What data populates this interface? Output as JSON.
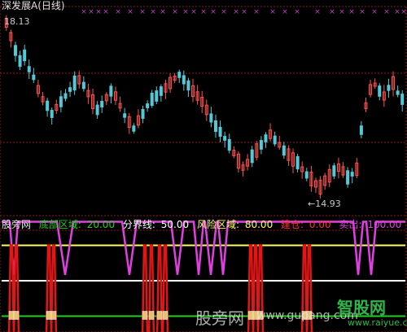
{
  "header": {
    "title": "深发展A(日线)",
    "high_label": "18.13",
    "low_label": "←14.93"
  },
  "indicator": {
    "name": "股旁网",
    "bottom_zone": {
      "label": "底部区域:",
      "value": "20.00"
    },
    "divider": {
      "label": "分界线:",
      "value": "50.00"
    },
    "risk_zone": {
      "label": "风险区域:",
      "value": "80.00"
    },
    "build": {
      "label": "建仓:",
      "value": "0.00"
    },
    "sell": {
      "label": "卖出:",
      "value": "100.00"
    }
  },
  "watermark": {
    "text": "股旁网",
    "url": "www.gupang.com"
  },
  "logo": {
    "text": "智股网",
    "url": "www.raiyue.com"
  },
  "colors": {
    "up": "#ff5050",
    "down": "#54c8d6",
    "build": "#e21616",
    "sell": "#e040e0",
    "risk": "#ffff66",
    "divider": "#ffffff",
    "bottom": "#22d022",
    "grid": "#8b1a1a",
    "marker": "#c040c0"
  }
}
